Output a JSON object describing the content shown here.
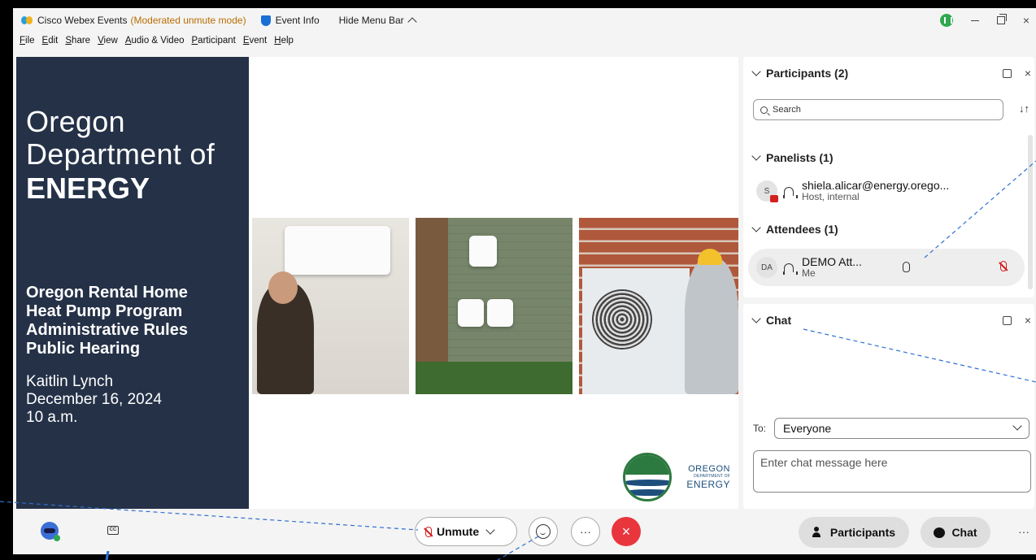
{
  "titlebar": {
    "app_name": "Cisco Webex Events",
    "mode": "(Moderated unmute mode)",
    "event_info": "Event Info",
    "hide_menu": "Hide Menu Bar",
    "close": "×"
  },
  "menu": [
    "File",
    "Edit",
    "Share",
    "View",
    "Audio & Video",
    "Participant",
    "Event",
    "Help"
  ],
  "slide": {
    "org_line1": "Oregon",
    "org_line2": "Department of",
    "org_line3": "ENERGY",
    "program": [
      "Oregon Rental Home",
      "Heat Pump Program",
      "Administrative Rules",
      "Public Hearing"
    ],
    "presenter": "Kaitlin Lynch",
    "date": "December 16, 2024",
    "time": "10 a.m.",
    "logo_line1": "OREGON",
    "logo_line2": "DEPARTMENT OF",
    "logo_line3": "ENERGY"
  },
  "participants_panel": {
    "title": "Participants (2)",
    "search_placeholder": "Search",
    "sort": "↓↑",
    "close": "×",
    "panelists_label": "Panelists (1)",
    "attendees_label": "Attendees (1)",
    "panelists": [
      {
        "initial": "S",
        "name": "shiela.alicar@energy.orego...",
        "role": "Host, internal"
      }
    ],
    "attendees": [
      {
        "initial": "DA",
        "name": "DEMO Att...",
        "role": "Me"
      }
    ]
  },
  "chat_panel": {
    "title": "Chat",
    "close": "×",
    "to_label": "To:",
    "to_value": "Everyone",
    "input_placeholder": "Enter chat message here"
  },
  "bottombar": {
    "cc_label": "CC",
    "unmute_label": "Unmute",
    "more": "···",
    "leave": "×",
    "participants_label": "Participants",
    "chat_label": "Chat",
    "overflow": "···"
  }
}
